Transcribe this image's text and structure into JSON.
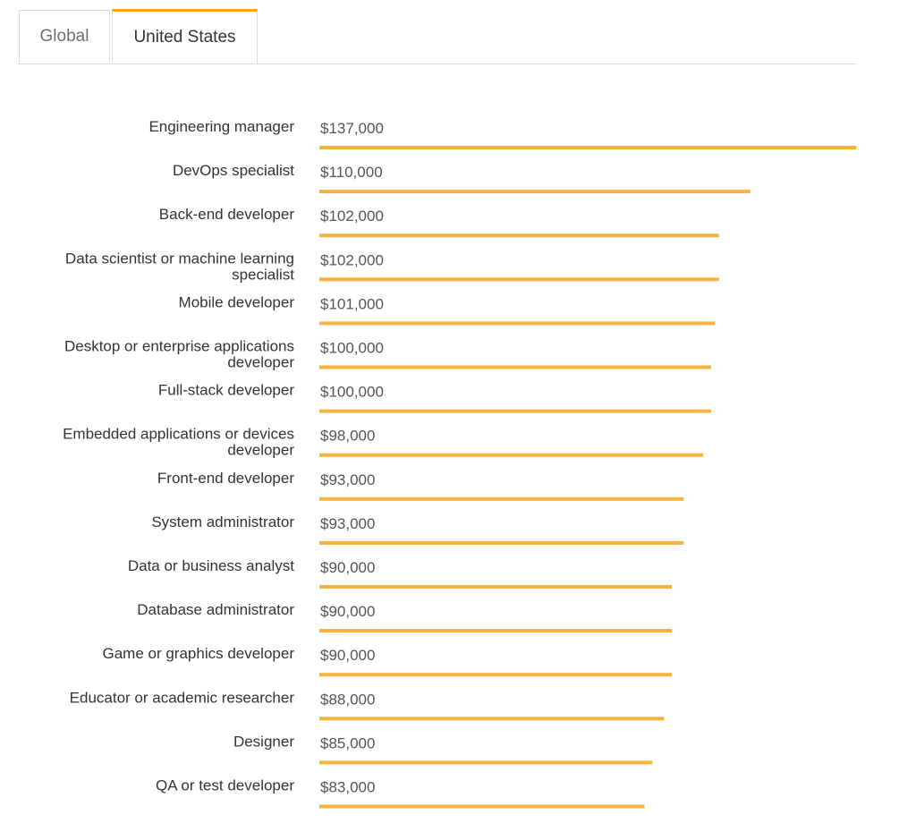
{
  "tabs": [
    {
      "label": "Global",
      "active": false
    },
    {
      "label": "United States",
      "active": true
    }
  ],
  "chart_data": {
    "type": "bar",
    "orientation": "horizontal",
    "bar_color": "#f7b33f",
    "categories": [
      [
        "Engineering manager"
      ],
      [
        "DevOps specialist"
      ],
      [
        "Back-end developer"
      ],
      [
        "Data scientist or machine learning",
        "specialist"
      ],
      [
        "Mobile developer"
      ],
      [
        "Desktop or enterprise applications",
        "developer"
      ],
      [
        "Full-stack developer"
      ],
      [
        "Embedded applications or devices",
        "developer"
      ],
      [
        "Front-end developer"
      ],
      [
        "System administrator"
      ],
      [
        "Data or business analyst"
      ],
      [
        "Database administrator"
      ],
      [
        "Game or graphics developer"
      ],
      [
        "Educator or academic researcher"
      ],
      [
        "Designer"
      ],
      [
        "QA or test developer"
      ]
    ],
    "values": [
      137000,
      110000,
      102000,
      102000,
      101000,
      100000,
      100000,
      98000,
      93000,
      93000,
      90000,
      90000,
      90000,
      88000,
      85000,
      83000
    ],
    "value_labels": [
      "$137,000",
      "$110,000",
      "$102,000",
      "$102,000",
      "$101,000",
      "$100,000",
      "$100,000",
      "$98,000",
      "$93,000",
      "$93,000",
      "$90,000",
      "$90,000",
      "$90,000",
      "$88,000",
      "$85,000",
      "$83,000"
    ],
    "xlim": [
      0,
      137000
    ]
  }
}
